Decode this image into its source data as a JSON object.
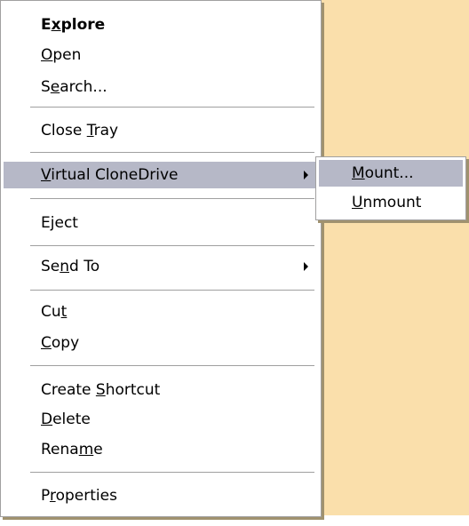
{
  "context_menu": {
    "items": [
      {
        "pre": "E",
        "u": "x",
        "post": "plore"
      },
      {
        "pre": "",
        "u": "O",
        "post": "pen"
      },
      {
        "pre": "S",
        "u": "e",
        "post": "arch..."
      },
      {
        "pre": "Close ",
        "u": "T",
        "post": "ray"
      },
      {
        "pre": "",
        "u": "V",
        "post": "irtual CloneDrive"
      },
      {
        "pre": "E",
        "u": "j",
        "post": "ect"
      },
      {
        "pre": "Se",
        "u": "n",
        "post": "d To"
      },
      {
        "pre": "Cu",
        "u": "t",
        "post": ""
      },
      {
        "pre": "",
        "u": "C",
        "post": "opy"
      },
      {
        "pre": "Create ",
        "u": "S",
        "post": "hortcut"
      },
      {
        "pre": "",
        "u": "D",
        "post": "elete"
      },
      {
        "pre": "Rena",
        "u": "m",
        "post": "e"
      },
      {
        "pre": "P",
        "u": "r",
        "post": "operties"
      }
    ]
  },
  "submenu": {
    "items": [
      {
        "pre": "",
        "u": "M",
        "post": "ount..."
      },
      {
        "pre": "",
        "u": "U",
        "post": "nmount"
      }
    ]
  },
  "colors": {
    "desktop": "#fadfab",
    "highlight": "#b6b8c7",
    "border": "#a1a0a0"
  }
}
